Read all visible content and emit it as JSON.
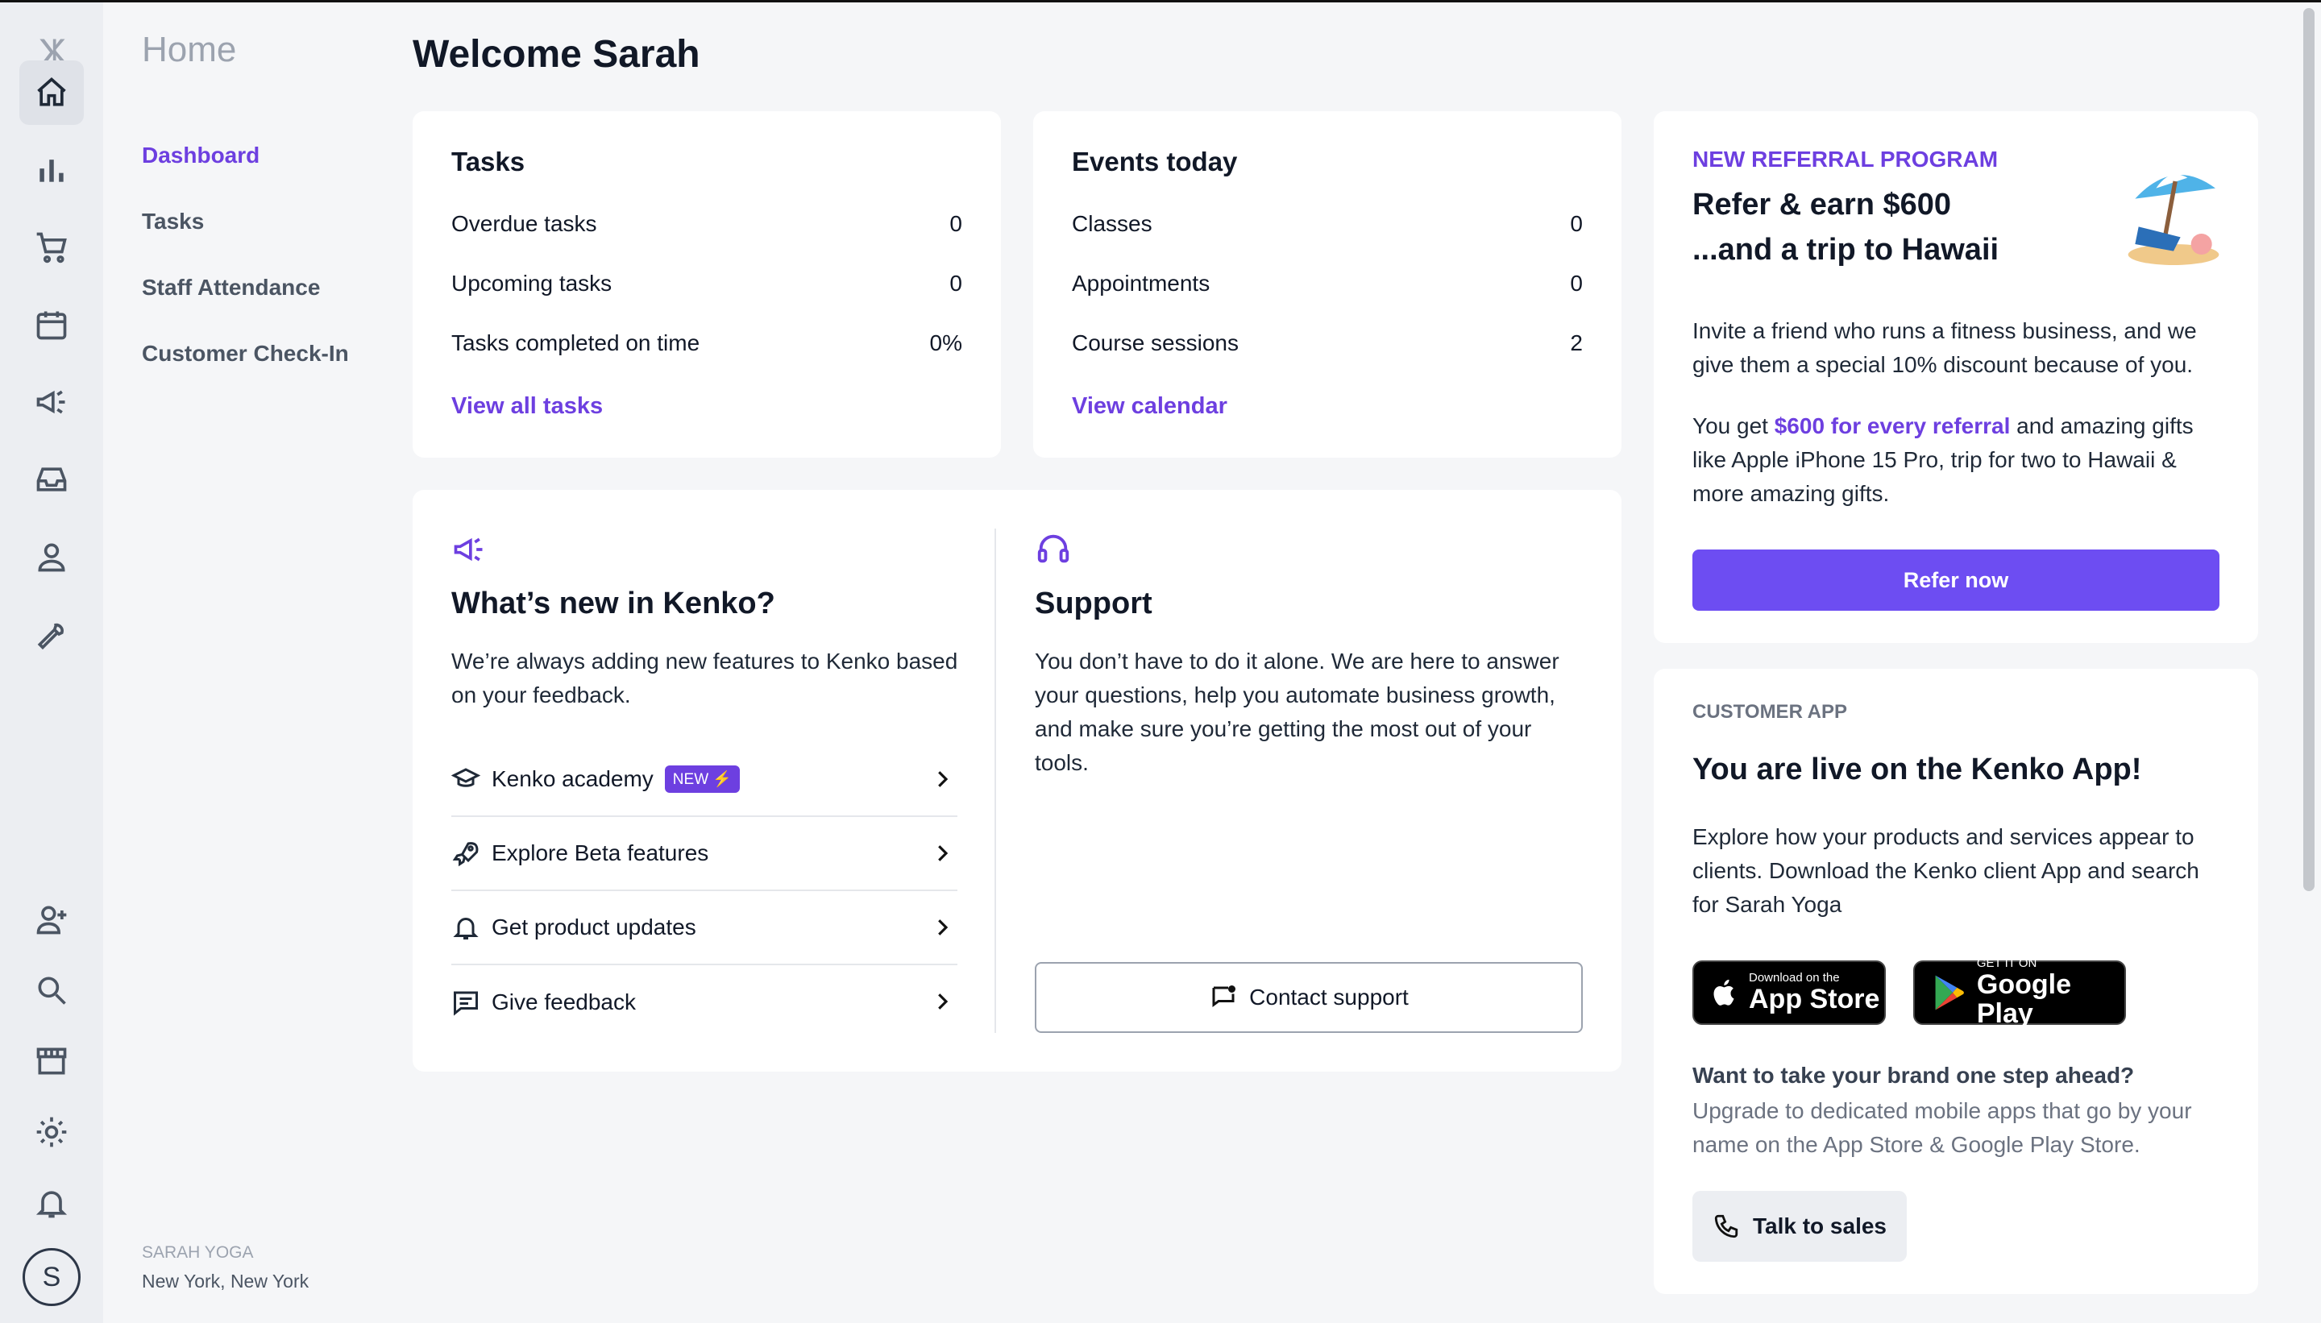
{
  "nav": {
    "home_label": "Home",
    "items": [
      {
        "label": "Dashboard"
      },
      {
        "label": "Tasks"
      },
      {
        "label": "Staff Attendance"
      },
      {
        "label": "Customer Check-In"
      }
    ],
    "business_name": "SARAH YOGA",
    "business_location": "New York, New York",
    "avatar_initial": "S"
  },
  "main": {
    "welcome": "Welcome Sarah",
    "tasks": {
      "title": "Tasks",
      "rows": [
        {
          "label": "Overdue tasks",
          "value": "0"
        },
        {
          "label": "Upcoming tasks",
          "value": "0"
        },
        {
          "label": "Tasks completed on time",
          "value": "0%"
        }
      ],
      "link": "View all tasks"
    },
    "events": {
      "title": "Events today",
      "rows": [
        {
          "label": "Classes",
          "value": "0"
        },
        {
          "label": "Appointments",
          "value": "0"
        },
        {
          "label": "Course sessions",
          "value": "2"
        }
      ],
      "link": "View calendar"
    },
    "whats_new": {
      "title": "What’s new in Kenko?",
      "body": "We’re always adding new features to Kenko based on your feedback.",
      "items": [
        {
          "label": "Kenko academy",
          "badge": "NEW ⚡"
        },
        {
          "label": "Explore Beta features"
        },
        {
          "label": "Get product updates"
        },
        {
          "label": "Give feedback"
        }
      ]
    },
    "support": {
      "title": "Support",
      "body": "You don’t have to do it alone. We are here to answer your questions, help you automate business growth, and make sure you’re getting the most out of your tools.",
      "button": "Contact support"
    }
  },
  "referral": {
    "eyebrow": "NEW REFERRAL PROGRAM",
    "title_line1": "Refer & earn $600",
    "title_line2": "...and a trip to Hawaii",
    "body1": "Invite a friend who runs a fitness business, and we give them a special 10% discount because of you.",
    "body2_prefix": "You get ",
    "body2_highlight": "$600 for every referral",
    "body2_suffix": " and amazing gifts like Apple iPhone 15 Pro, trip for two to Hawaii & more amazing gifts.",
    "button": "Refer now"
  },
  "customer_app": {
    "eyebrow": "CUSTOMER APP",
    "title": "You are live on the Kenko App!",
    "body": "Explore how your products and services appear to clients. Download the Kenko client App and search for Sarah Yoga",
    "app_store_small": "Download on the",
    "app_store_large": "App Store",
    "play_small": "GET IT ON",
    "play_large": "Google Play",
    "upsell_title": "Want to take your brand one step ahead?",
    "upsell_body": "Upgrade to dedicated mobile apps that go by your name on the App Store & Google Play Store.",
    "button": "Talk to sales"
  },
  "colors": {
    "accent": "#6d3fe0",
    "primary_button": "#6d4df2"
  }
}
